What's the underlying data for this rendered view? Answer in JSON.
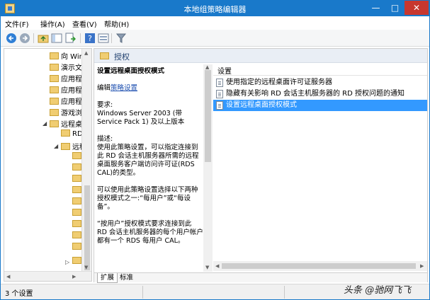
{
  "window": {
    "title": "本地组策略编辑器"
  },
  "menubar": {
    "items": [
      "文件(F)",
      "操作(A)",
      "查看(V)",
      "帮助(H)"
    ]
  },
  "toolbar": {
    "icons": [
      "back-arrow-icon",
      "forward-arrow-icon",
      "up-folder-icon",
      "show-tree-icon",
      "export-list-icon",
      "help-icon",
      "view-icon",
      "filter-icon"
    ]
  },
  "tree": {
    "items": [
      {
        "label": "向 Wir"
      },
      {
        "label": "演示文"
      },
      {
        "label": "应用程"
      },
      {
        "label": "应用程"
      },
      {
        "label": "应用程"
      },
      {
        "label": "游戏浏"
      },
      {
        "label": "远程桌"
      },
      {
        "label": "RD"
      },
      {
        "label": "远程"
      }
    ]
  },
  "header": {
    "section_title": "授权"
  },
  "description": {
    "title": "设置远程桌面授权模式",
    "edit_prefix": "编辑",
    "edit_link": "策略设置",
    "req_label": "要求:",
    "req_value": "Windows Server 2003 (带 Service Pack 1) 及以上版本",
    "desc_label": "描述:",
    "desc_body": "使用此策略设置，可以指定连接到此 RD 会话主机服务器所需的远程桌面服务客户端访问许可证(RDS CAL)的类型。",
    "desc_para2": "可以使用此策略设置选择以下两种授权模式之一:“每用户”或“每设备”。",
    "desc_para3": "“按用户”授权模式要求连接到此 RD 会话主机服务器的每个用户帐户都有一个 RDS 每用户 CAL。"
  },
  "list": {
    "column_header": "设置",
    "rows": [
      {
        "label": "使用指定的远程桌面许可证服务器",
        "selected": false
      },
      {
        "label": "隐藏有关影响 RD 会话主机服务器的 RD 授权问题的通知",
        "selected": false
      },
      {
        "label": "设置远程桌面授权模式",
        "selected": true
      }
    ]
  },
  "tabs": {
    "items": [
      "扩展",
      "标准"
    ]
  },
  "status": {
    "text": "3 个设置"
  },
  "watermark": {
    "text": "头条 @驰网飞飞"
  },
  "colors": {
    "titlebar": "#1979ca",
    "selection": "#3399ff",
    "close": "#c7372f"
  }
}
